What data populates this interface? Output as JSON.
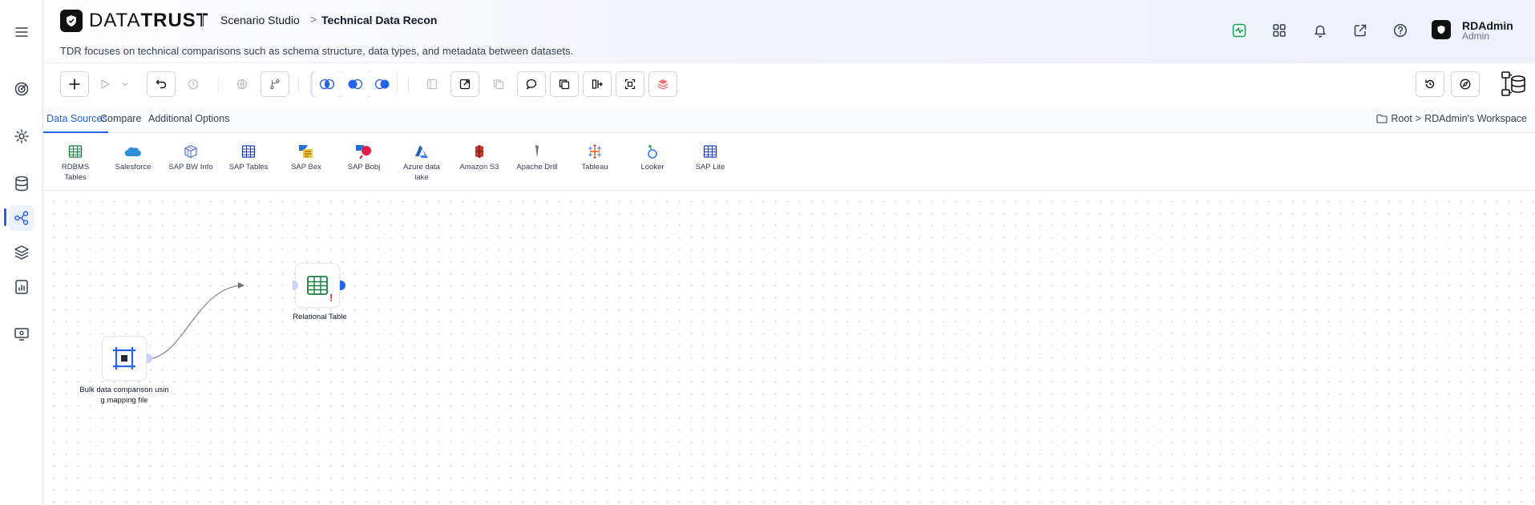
{
  "header": {
    "logo": {
      "data": "DATA",
      "trust": "TRUST"
    },
    "breadcrumb": {
      "studio": "Scenario Studio",
      "separator": ">",
      "current": "Technical Data Recon"
    },
    "subtitle": "TDR focuses on technical comparisons such as schema structure, data types, and metadata between datasets.",
    "icons": [
      "activity-icon",
      "apps-grid-icon",
      "bell-icon",
      "external-link-icon",
      "help-icon"
    ],
    "user": {
      "name": "RDAdmin",
      "role": "Admin"
    }
  },
  "sidebar": {
    "items": [
      {
        "icon": "menu-icon"
      },
      {
        "icon": "target-icon"
      },
      {
        "icon": "settings-icon"
      },
      {
        "icon": "database-icon"
      },
      {
        "icon": "workflow-icon",
        "active": true
      },
      {
        "icon": "layers-icon"
      },
      {
        "icon": "report-icon"
      },
      {
        "icon": "monitor-settings-icon"
      }
    ]
  },
  "tabs": {
    "items": [
      {
        "label": "Data Sources",
        "active": true
      },
      {
        "label": "Compare"
      },
      {
        "label": "Additional Options"
      }
    ],
    "workspace": {
      "root": "Root",
      "separator": ">",
      "name": "RDAdmin's Workspace"
    }
  },
  "palette": {
    "items": [
      {
        "label": "RDBMS Tables",
        "icon": "table-green-icon"
      },
      {
        "label": "Salesforce",
        "icon": "salesforce-icon"
      },
      {
        "label": "SAP BW Info",
        "icon": "cube-icon"
      },
      {
        "label": "SAP Tables",
        "icon": "table-blue-icon"
      },
      {
        "label": "SAP Bex",
        "icon": "sap-bex-icon"
      },
      {
        "label": "SAP Bobj",
        "icon": "sap-bobj-icon"
      },
      {
        "label": "Azure data lake",
        "icon": "azure-icon"
      },
      {
        "label": "Amazon S3",
        "icon": "s3-icon"
      },
      {
        "label": "Apache Drill",
        "icon": "drill-icon"
      },
      {
        "label": "Tableau",
        "icon": "tableau-icon"
      },
      {
        "label": "Looker",
        "icon": "looker-icon"
      },
      {
        "label": "SAP Lite",
        "icon": "table-blue-icon"
      }
    ]
  },
  "canvas": {
    "nodes": [
      {
        "label": "Relational Table",
        "icon": "table-green-icon",
        "warning": "!"
      },
      {
        "label_line1": "Bulk data comparison usin",
        "label_line2": "g mapping file",
        "icon": "bulk-compare-icon"
      }
    ]
  },
  "colors": {
    "accent": "#2563eb",
    "group_bg": "#dbe4fb",
    "warning": "#dc2626",
    "success": "#16a34a"
  }
}
